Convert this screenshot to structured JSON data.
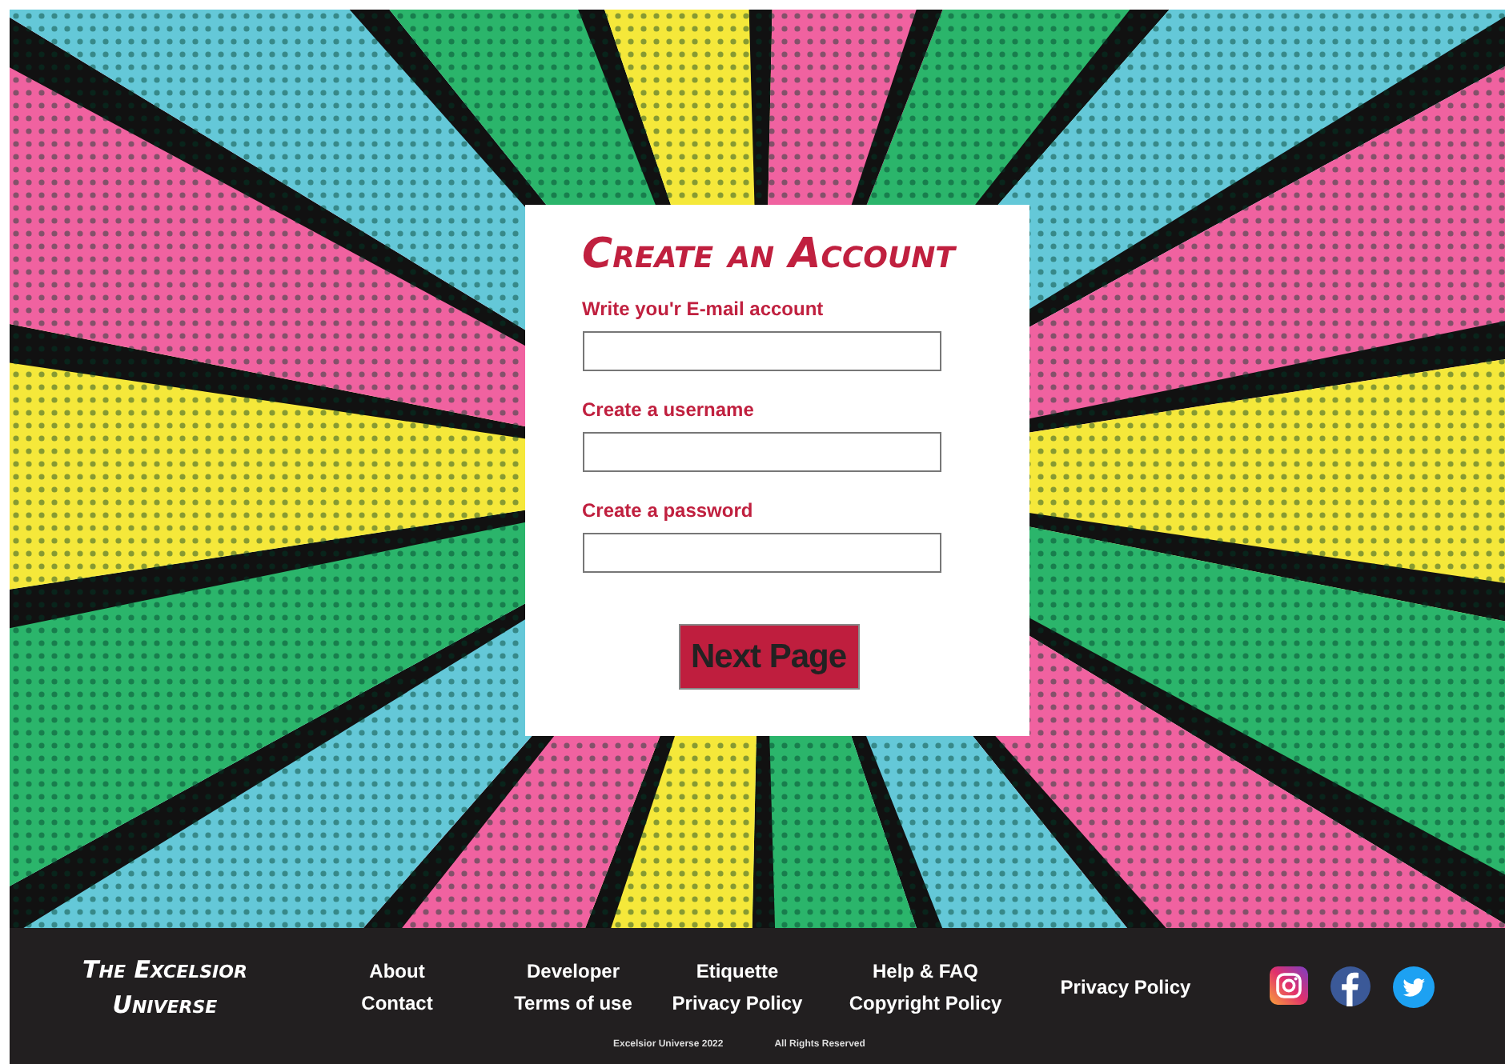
{
  "form": {
    "title": "Create an Account",
    "fields": [
      {
        "label": "Write you'r E-mail account"
      },
      {
        "label": "Create a username"
      },
      {
        "label": "Create a password"
      }
    ],
    "submit": "Next Page"
  },
  "footer": {
    "brand": "The Excelsior Universe",
    "link_columns": [
      [
        "About",
        "Contact"
      ],
      [
        "Developer",
        "Terms of use"
      ],
      [
        "Etiquette",
        "Privacy Policy"
      ],
      [
        "Help & FAQ",
        "Copyright Policy"
      ],
      [
        "Privacy Policy"
      ]
    ],
    "copyright": "Excelsior Universe 2022",
    "rights": "All Rights Reserved"
  }
}
